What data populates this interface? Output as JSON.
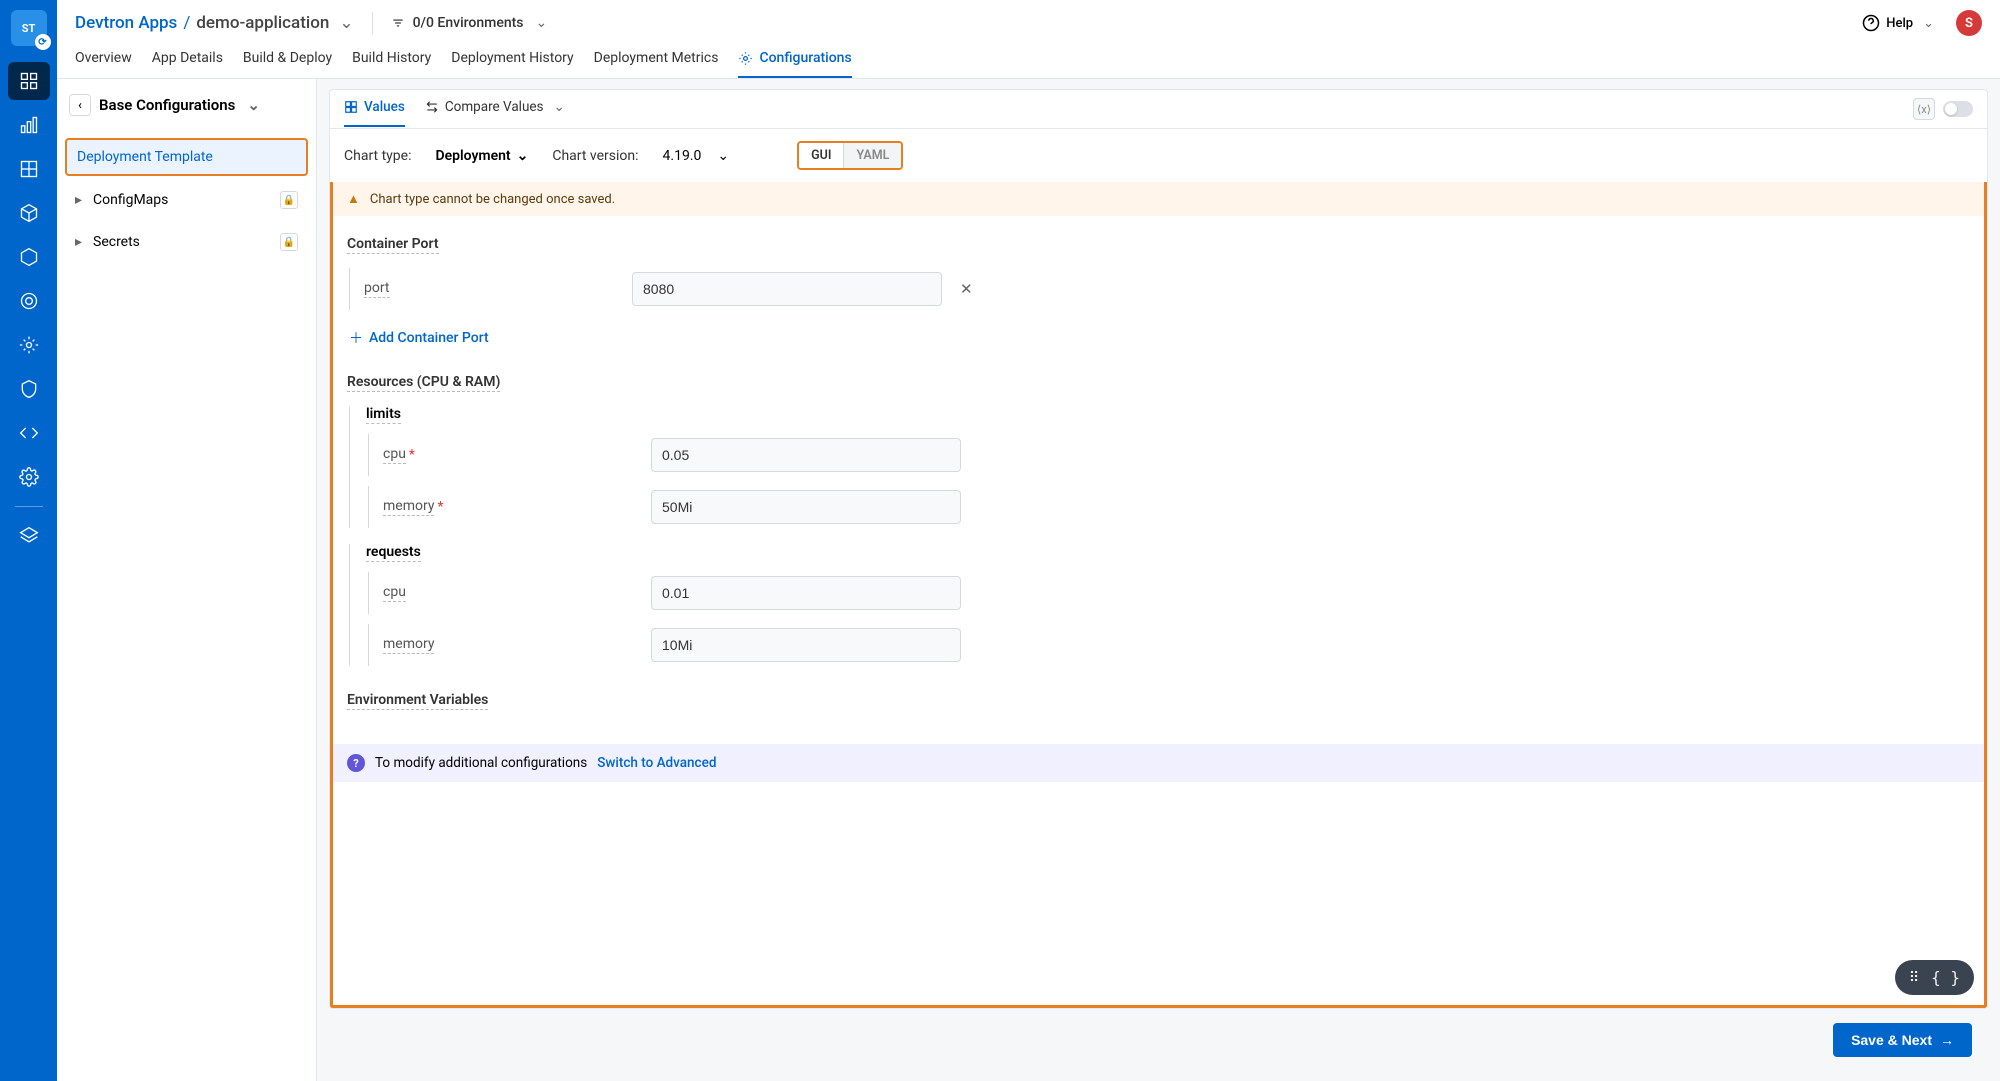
{
  "header": {
    "breadcrumb_root": "Devtron Apps",
    "breadcrumb_sep": "/",
    "app_name": "demo-application",
    "envs_label": "0/0 Environments",
    "help_label": "Help",
    "avatar_initial": "S"
  },
  "tabs": {
    "items": [
      "Overview",
      "App Details",
      "Build & Deploy",
      "Build History",
      "Deployment History",
      "Deployment Metrics",
      "Configurations"
    ]
  },
  "cfgnav": {
    "back_label": "Base Configurations",
    "items": [
      "Deployment Template",
      "ConfigMaps",
      "Secrets"
    ]
  },
  "subtabs": {
    "values": "Values",
    "compare": "Compare Values"
  },
  "chart": {
    "type_label": "Chart type:",
    "type_value": "Deployment",
    "version_label": "Chart version:",
    "version_value": "4.19.0",
    "seg_gui": "GUI",
    "seg_yaml": "YAML"
  },
  "warning": "Chart type cannot be changed once saved.",
  "form": {
    "container_port": {
      "title": "Container Port",
      "field_label": "port",
      "field_value": "8080",
      "add_label": "Add Container Port"
    },
    "resources": {
      "title": "Resources (CPU & RAM)",
      "limits": {
        "title": "limits",
        "cpu_label": "cpu",
        "cpu_value": "0.05",
        "memory_label": "memory",
        "memory_value": "50Mi"
      },
      "requests": {
        "title": "requests",
        "cpu_label": "cpu",
        "cpu_value": "0.01",
        "memory_label": "memory",
        "memory_value": "10Mi"
      }
    },
    "env_vars": {
      "title": "Environment Variables"
    }
  },
  "infobar": {
    "text": "To modify additional configurations",
    "link": "Switch to Advanced"
  },
  "footer": {
    "save_label": "Save & Next"
  }
}
